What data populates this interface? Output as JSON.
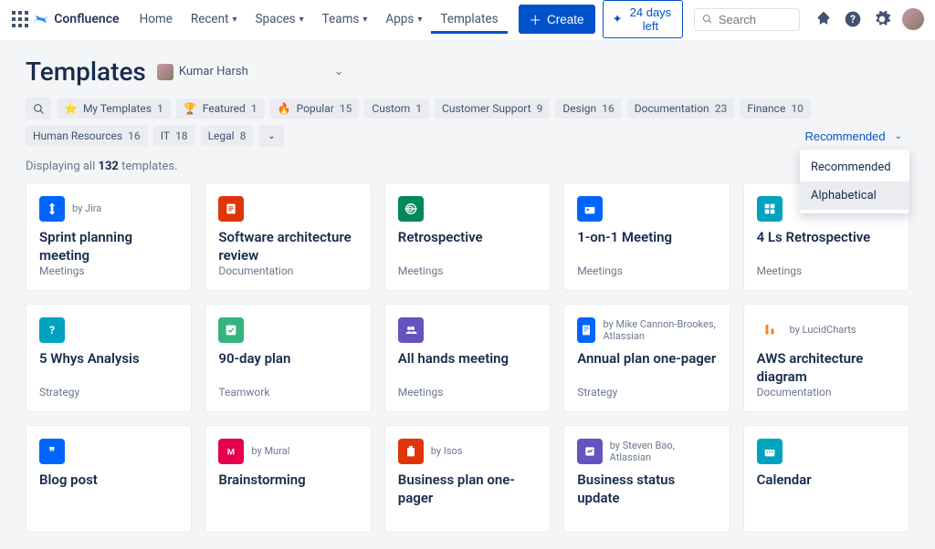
{
  "topbar": {
    "brand": "Confluence",
    "nav": [
      "Home",
      "Recent",
      "Spaces",
      "Teams",
      "Apps",
      "Templates"
    ],
    "create_label": "Create",
    "trial_label": "24 days left",
    "search_placeholder": "Search"
  },
  "page": {
    "title": "Templates",
    "user": "Kumar Harsh",
    "count_prefix": "Displaying all ",
    "count_number": "132",
    "count_suffix": " templates."
  },
  "filters": [
    {
      "label": "My Templates",
      "count": "1",
      "icon": "star"
    },
    {
      "label": "Featured",
      "count": "1",
      "icon": "trophy"
    },
    {
      "label": "Popular",
      "count": "15",
      "icon": "flame"
    },
    {
      "label": "Custom",
      "count": "1"
    },
    {
      "label": "Customer Support",
      "count": "9"
    },
    {
      "label": "Design",
      "count": "16"
    },
    {
      "label": "Documentation",
      "count": "23"
    },
    {
      "label": "Finance",
      "count": "10"
    },
    {
      "label": "Human Resources",
      "count": "16"
    },
    {
      "label": "IT",
      "count": "18"
    },
    {
      "label": "Legal",
      "count": "8"
    }
  ],
  "sort": {
    "selected": "Recommended",
    "options": [
      "Recommended",
      "Alphabetical"
    ]
  },
  "cards": [
    {
      "title": "Sprint planning meeting",
      "category": "Meetings",
      "byline": "by Jira",
      "color": "#0065FF",
      "icon": "jira"
    },
    {
      "title": "Software architecture review",
      "category": "Documentation",
      "byline": "",
      "color": "#DE350B",
      "icon": "doc"
    },
    {
      "title": "Retrospective",
      "category": "Meetings",
      "byline": "",
      "color": "#00875A",
      "icon": "retro"
    },
    {
      "title": "1-on-1 Meeting",
      "category": "Meetings",
      "byline": "",
      "color": "#0065FF",
      "icon": "cal"
    },
    {
      "title": "4 Ls Retrospective",
      "category": "Meetings",
      "byline": "",
      "color": "#00A3BF",
      "icon": "grid"
    },
    {
      "title": "5 Whys Analysis",
      "category": "Strategy",
      "byline": "",
      "color": "#00A3BF",
      "icon": "question"
    },
    {
      "title": "90-day plan",
      "category": "Teamwork",
      "byline": "",
      "color": "#36B37E",
      "icon": "check"
    },
    {
      "title": "All hands meeting",
      "category": "Meetings",
      "byline": "",
      "color": "#6554C0",
      "icon": "people"
    },
    {
      "title": "Annual plan one-pager",
      "category": "Strategy",
      "byline": "by Mike Cannon-Brookes, Atlassian",
      "color": "#0065FF",
      "icon": "page"
    },
    {
      "title": "AWS architecture diagram",
      "category": "Documentation",
      "byline": "by LucidCharts",
      "color": "#FFFFFF",
      "icon": "lucid"
    },
    {
      "title": "Blog post",
      "category": "",
      "byline": "",
      "color": "#0065FF",
      "icon": "quote"
    },
    {
      "title": "Brainstorming",
      "category": "",
      "byline": "by Mural",
      "color": "#E6004C",
      "icon": "M"
    },
    {
      "title": "Business plan one-pager",
      "category": "",
      "byline": "by Isos",
      "color": "#DE350B",
      "icon": "clip"
    },
    {
      "title": "Business status update",
      "category": "",
      "byline": "by Steven Bao, Atlassian",
      "color": "#6554C0",
      "icon": "status"
    },
    {
      "title": "Calendar",
      "category": "",
      "byline": "",
      "color": "#00A3BF",
      "icon": "calendar"
    }
  ]
}
